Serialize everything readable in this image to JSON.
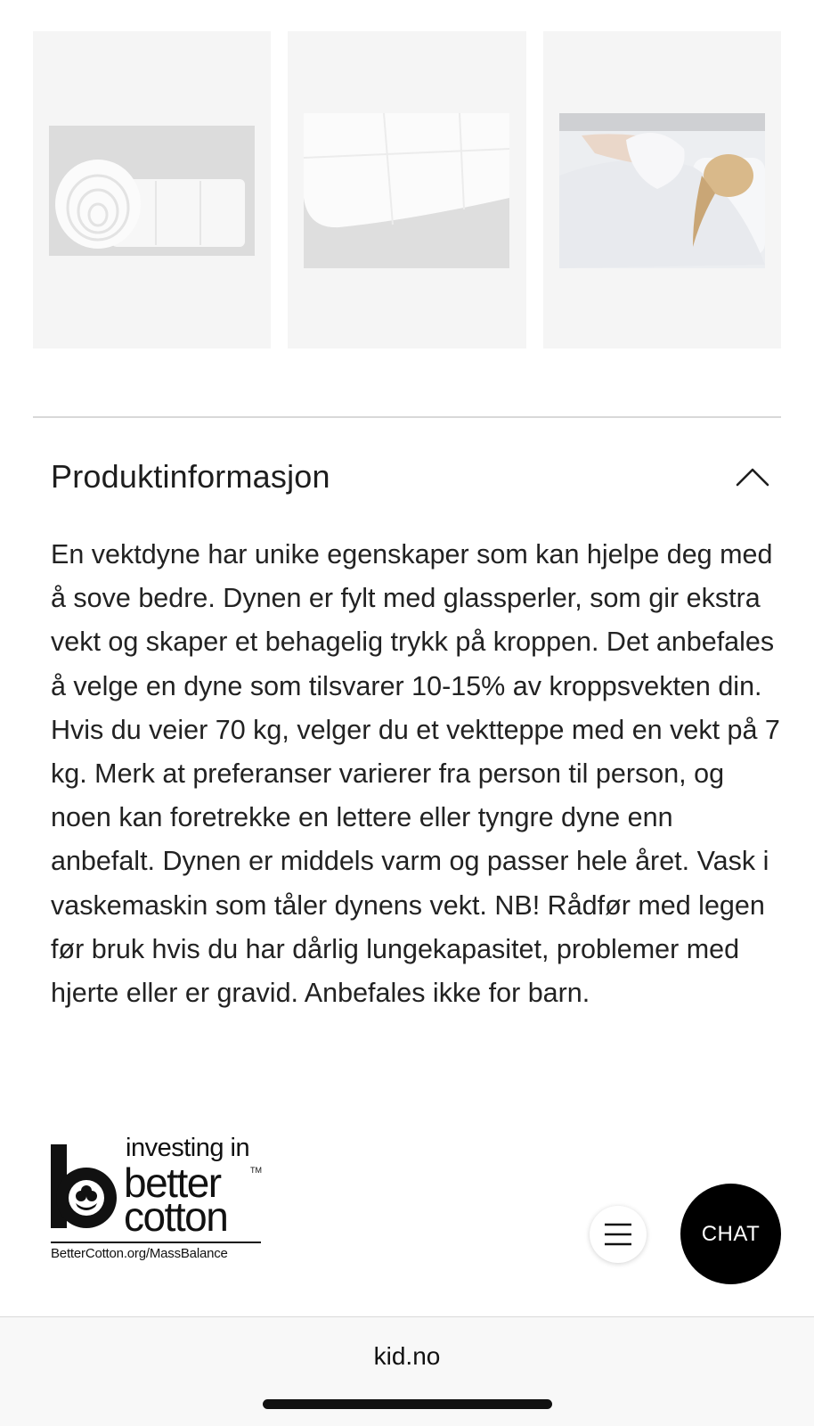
{
  "gallery": {
    "images": [
      {
        "alt": "rolled-duvet-image"
      },
      {
        "alt": "duvet-corner-image"
      },
      {
        "alt": "woman-sleeping-image"
      }
    ]
  },
  "product_info": {
    "title": "Produktinformasjon",
    "expanded": true,
    "toggle_icon": "chevron-up-icon",
    "body": "En vektdyne har unike egenskaper som kan hjelpe deg med å sove bedre. Dynen er fylt med glassperler, som gir ekstra vekt og skaper et behagelig trykk på kroppen. Det anbefales å velge en dyne som tilsvarer 10-15% av kroppsvekten din. Hvis du veier 70 kg, velger du et vektteppe med en vekt på 7 kg. Merk at preferanser varierer fra person til person, og noen kan foretrekke en lettere eller tyngre dyne enn anbefalt. Dynen er middels varm og passer hele året. Vask i vaskemaskin som tåler dynens vekt. NB! Rådfør med legen før bruk hvis du har dårlig lungekapasitet, problemer med hjerte eller er gravid. Anbefales ikke for barn."
  },
  "better_cotton_logo": {
    "line1": "investing in",
    "line2": "better",
    "line3": "cotton",
    "trademark": "TM",
    "url": "BetterCotton.org/MassBalance"
  },
  "floating": {
    "menu_icon": "hamburger-menu-icon",
    "chat_label": "CHAT"
  },
  "browser": {
    "url": "kid.no"
  },
  "colors": {
    "tile_background": "#f5f5f5",
    "divider": "#d8d8d8",
    "text": "#222222",
    "chat_button": "#000000",
    "url_bar": "#f8f8f8"
  }
}
